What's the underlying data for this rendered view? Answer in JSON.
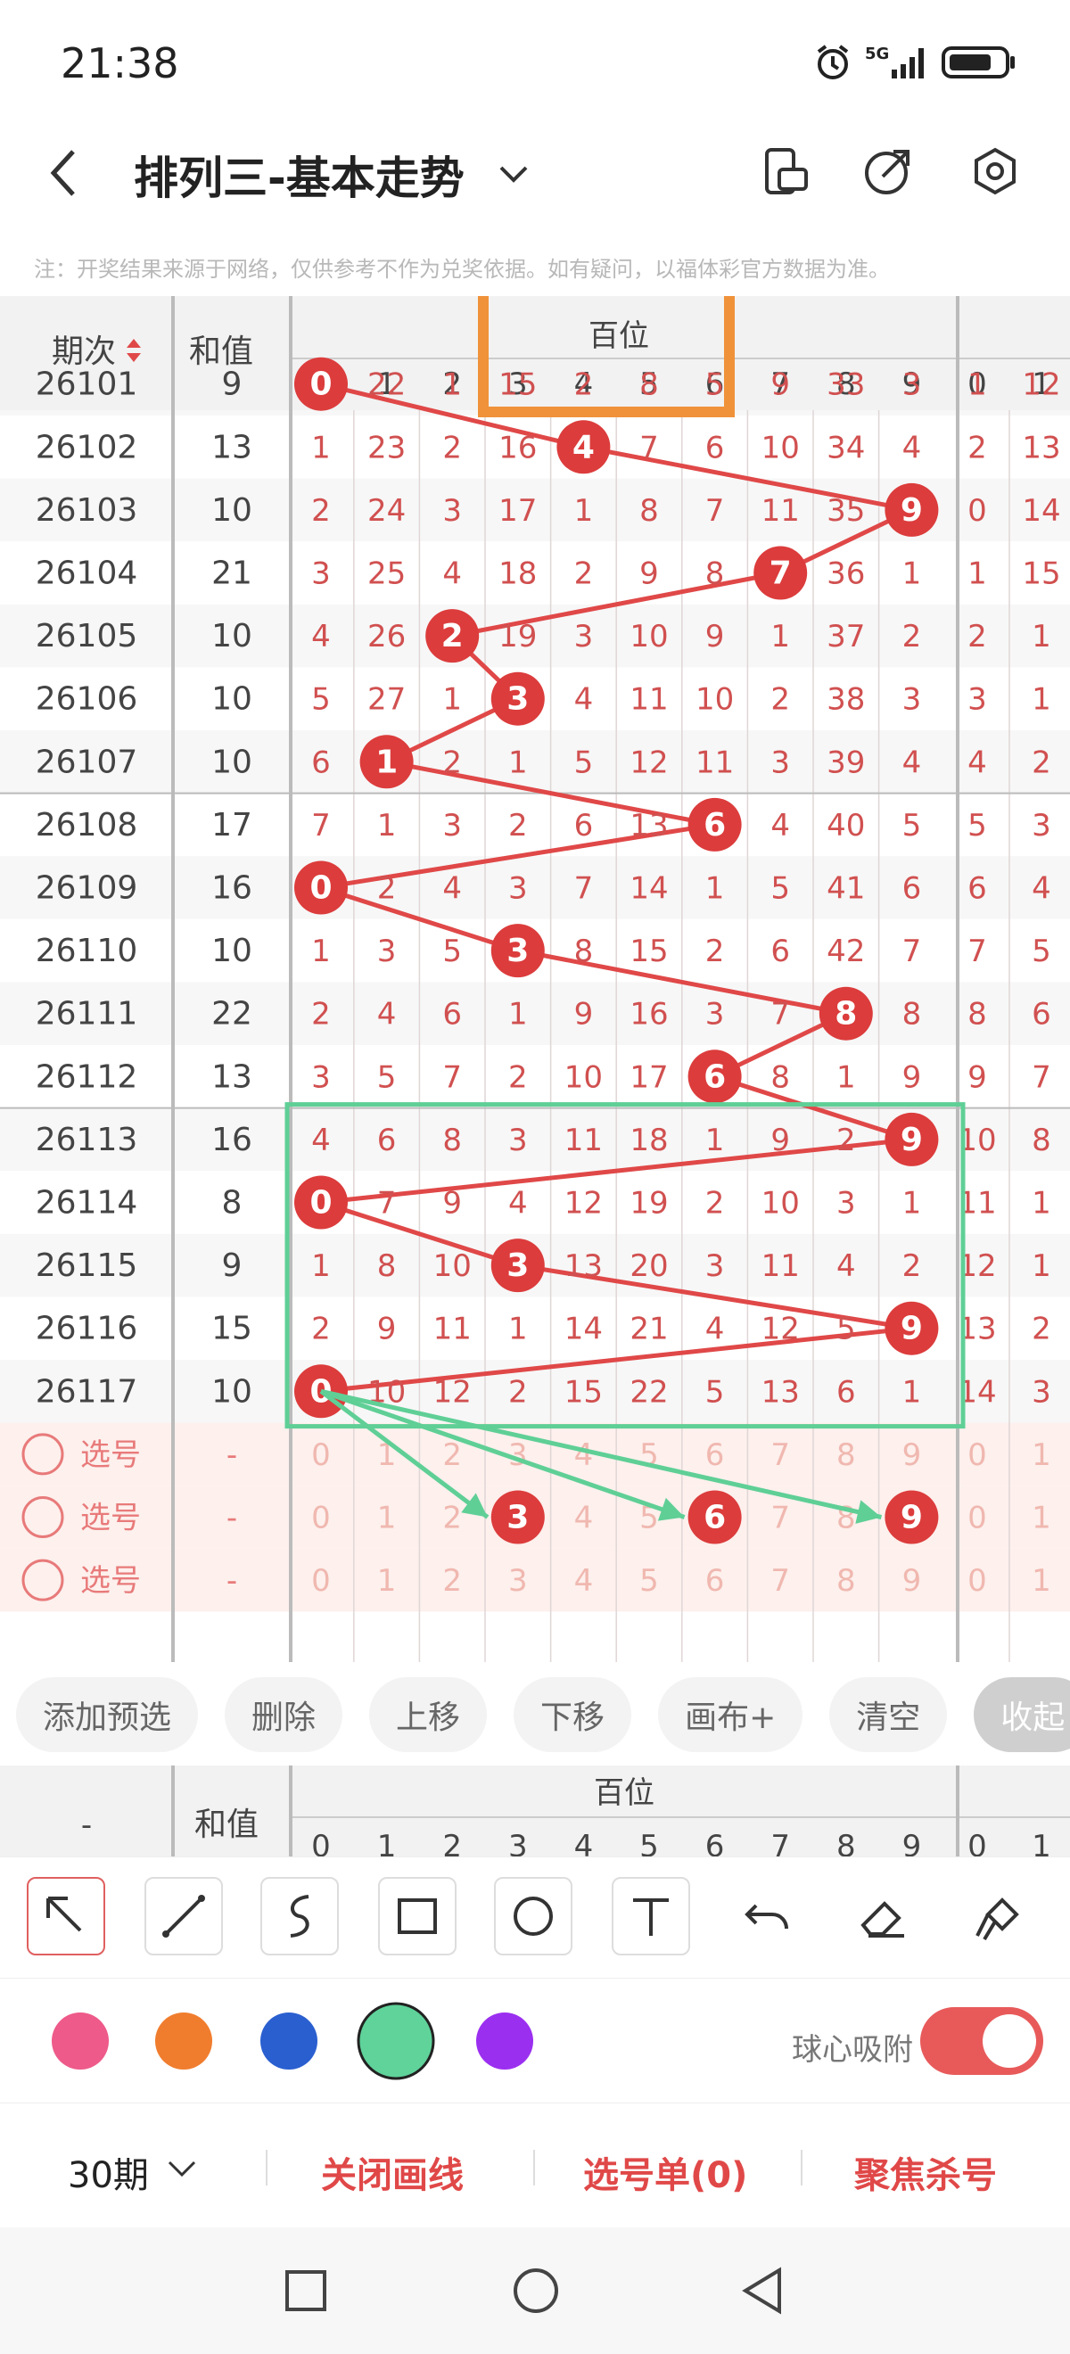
{
  "status_bar": {
    "time": "21:38",
    "network": "5G"
  },
  "header": {
    "title": "排列三-基本走势",
    "back_icon": "back-arrow-icon",
    "dropdown_icon": "chevron-down-icon",
    "icons": [
      "phone-layout-icon",
      "share-icon",
      "settings-icon"
    ]
  },
  "notice": "注：开奖结果来源于网络，仅供参考不作为兑奖依据。如有疑问，以福体彩官方数据为准。",
  "table": {
    "col_issue": "期次",
    "col_sum": "和值",
    "group_label": "百位",
    "digits": [
      "0",
      "1",
      "2",
      "3",
      "4",
      "5",
      "6",
      "7",
      "8",
      "9"
    ],
    "next_digits": [
      "0",
      "1"
    ],
    "rows": [
      {
        "issue": "26101",
        "sum": "9",
        "cells": [
          "0",
          "22",
          "1",
          "15",
          "2",
          "8",
          "5",
          "9",
          "33",
          "3"
        ],
        "next": [
          "1",
          "12"
        ]
      },
      {
        "issue": "26102",
        "sum": "13",
        "cells": [
          "1",
          "23",
          "2",
          "16",
          "4",
          "7",
          "6",
          "10",
          "34",
          "4"
        ],
        "next": [
          "2",
          "13"
        ]
      },
      {
        "issue": "26103",
        "sum": "10",
        "cells": [
          "2",
          "24",
          "3",
          "17",
          "1",
          "8",
          "7",
          "11",
          "35",
          "9"
        ],
        "next": [
          "0",
          "14"
        ]
      },
      {
        "issue": "26104",
        "sum": "21",
        "cells": [
          "3",
          "25",
          "4",
          "18",
          "2",
          "9",
          "8",
          "7",
          "36",
          "1"
        ],
        "next": [
          "1",
          "15"
        ]
      },
      {
        "issue": "26105",
        "sum": "10",
        "cells": [
          "4",
          "26",
          "2",
          "19",
          "3",
          "10",
          "9",
          "1",
          "37",
          "2"
        ],
        "next": [
          "2",
          "1"
        ]
      },
      {
        "issue": "26106",
        "sum": "10",
        "cells": [
          "5",
          "27",
          "1",
          "3",
          "4",
          "11",
          "10",
          "2",
          "38",
          "3"
        ],
        "next": [
          "3",
          "1"
        ]
      },
      {
        "issue": "26107",
        "sum": "10",
        "cells": [
          "6",
          "1",
          "2",
          "1",
          "5",
          "12",
          "11",
          "3",
          "39",
          "4"
        ],
        "next": [
          "4",
          "2"
        ]
      },
      {
        "issue": "26108",
        "sum": "17",
        "cells": [
          "7",
          "1",
          "3",
          "2",
          "6",
          "13",
          "6",
          "4",
          "40",
          "5"
        ],
        "next": [
          "5",
          "3"
        ]
      },
      {
        "issue": "26109",
        "sum": "16",
        "cells": [
          "0",
          "2",
          "4",
          "3",
          "7",
          "14",
          "1",
          "5",
          "41",
          "6"
        ],
        "next": [
          "6",
          "4"
        ]
      },
      {
        "issue": "26110",
        "sum": "10",
        "cells": [
          "1",
          "3",
          "5",
          "3",
          "8",
          "15",
          "2",
          "6",
          "42",
          "7"
        ],
        "next": [
          "7",
          "5"
        ]
      },
      {
        "issue": "26111",
        "sum": "22",
        "cells": [
          "2",
          "4",
          "6",
          "1",
          "9",
          "16",
          "3",
          "7",
          "8",
          "8"
        ],
        "next": [
          "8",
          "6"
        ]
      },
      {
        "issue": "26112",
        "sum": "13",
        "cells": [
          "3",
          "5",
          "7",
          "2",
          "10",
          "17",
          "6",
          "8",
          "1",
          "9"
        ],
        "next": [
          "9",
          "7"
        ]
      },
      {
        "issue": "26113",
        "sum": "16",
        "cells": [
          "4",
          "6",
          "8",
          "3",
          "11",
          "18",
          "1",
          "9",
          "2",
          "9"
        ],
        "next": [
          "10",
          "8"
        ]
      },
      {
        "issue": "26114",
        "sum": "8",
        "cells": [
          "0",
          "7",
          "9",
          "4",
          "12",
          "19",
          "2",
          "10",
          "3",
          "1"
        ],
        "next": [
          "11",
          "1"
        ]
      },
      {
        "issue": "26115",
        "sum": "9",
        "cells": [
          "1",
          "8",
          "10",
          "3",
          "13",
          "20",
          "3",
          "11",
          "4",
          "2"
        ],
        "next": [
          "12",
          "1"
        ]
      },
      {
        "issue": "26116",
        "sum": "15",
        "cells": [
          "2",
          "9",
          "11",
          "1",
          "14",
          "21",
          "4",
          "12",
          "5",
          "9"
        ],
        "next": [
          "13",
          "2"
        ]
      },
      {
        "issue": "26117",
        "sum": "10",
        "cells": [
          "0",
          "10",
          "12",
          "2",
          "15",
          "22",
          "5",
          "13",
          "6",
          "1"
        ],
        "next": [
          "14",
          "3"
        ]
      }
    ],
    "pick_label": "选号",
    "pick_sum": "-",
    "pick_rows": [
      [
        "0",
        "1",
        "2",
        "3",
        "4",
        "5",
        "6",
        "7",
        "8",
        "9"
      ],
      [
        "0",
        "1",
        "2",
        "3",
        "4",
        "5",
        "6",
        "7",
        "8",
        "9"
      ],
      [
        "0",
        "1",
        "2",
        "3",
        "4",
        "5",
        "6",
        "7",
        "8",
        "9"
      ]
    ],
    "pick_next": [
      "0",
      "1"
    ]
  },
  "actions": [
    "添加预选",
    "删除",
    "上移",
    "下移",
    "画布+",
    "清空",
    "收起"
  ],
  "sub_header": {
    "issue": "-",
    "sum": "和值",
    "group_label": "百位"
  },
  "tools": [
    "pointer-arrow-icon",
    "line-tool-icon",
    "curve-tool-icon",
    "rectangle-tool-icon",
    "circle-tool-icon",
    "text-tool-icon",
    "undo-icon",
    "eraser-icon",
    "brush-icon"
  ],
  "palette": {
    "colors": [
      "#ee5a8a",
      "#f07d2e",
      "#2a5fd0",
      "#5fd39a",
      "#9b2ff0"
    ],
    "selected_index": 3
  },
  "snap": {
    "label": "球心吸附",
    "enabled": true
  },
  "bottom": {
    "period": "30期",
    "close_draw": "关闭画线",
    "pick_list": "选号单(0)",
    "focus_kill": "聚焦杀号"
  },
  "theme": {
    "red": "#e04848",
    "ball": "#dc3c3c",
    "green": "#5fcf96",
    "orange": "#f0923a"
  }
}
